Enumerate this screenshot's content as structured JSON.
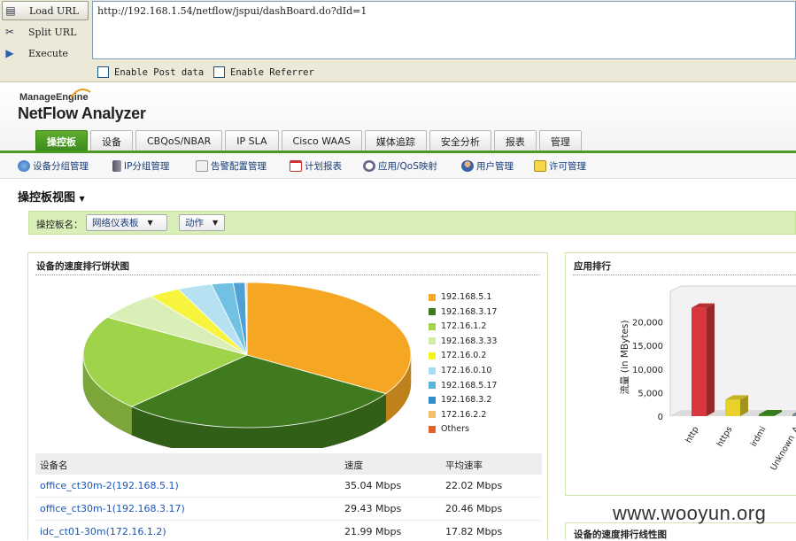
{
  "hackbar": {
    "load_url": "Load URL",
    "split_url": "Split URL",
    "execute": "Execute",
    "url": "http://192.168.1.54/netflow/jspui/dashBoard.do?dId=1",
    "enable_post": "Enable Post data",
    "enable_referrer": "Enable Referrer"
  },
  "brand": {
    "company": "ManageEngine",
    "product": "NetFlow Analyzer",
    "accent": "#4a9a22"
  },
  "tabs": [
    "操控板",
    "设备",
    "CBQoS/NBAR",
    "IP SLA",
    "Cisco WAAS",
    "媒体追踪",
    "安全分析",
    "报表",
    "管理"
  ],
  "subnav": [
    "设备分组管理",
    "IP分组管理",
    "告警配置管理",
    "计划报表",
    "应用/QoS映射",
    "用户管理",
    "许可管理"
  ],
  "page_title": "操控板视图",
  "dashboard": {
    "label": "操控板名：",
    "selected": "网络仪表板",
    "action": "动作"
  },
  "pie_panel": {
    "title": "设备的速度排行饼状图",
    "legend": [
      {
        "name": "192.168.5.1",
        "color": "#f5a623"
      },
      {
        "name": "192.168.3.17",
        "color": "#3f7a1e"
      },
      {
        "name": "172.16.1.2",
        "color": "#9fd34a"
      },
      {
        "name": "192.168.3.33",
        "color": "#d3ecaa"
      },
      {
        "name": "172.16.0.2",
        "color": "#f4f21a"
      },
      {
        "name": "172.16.0.10",
        "color": "#a8dcf0"
      },
      {
        "name": "192.168.5.17",
        "color": "#58b6de"
      },
      {
        "name": "192.168.3.2",
        "color": "#2f8fce"
      },
      {
        "name": "172.16.2.2",
        "color": "#f3c06a"
      },
      {
        "name": "Others",
        "color": "#e0622a"
      }
    ]
  },
  "table": {
    "headers": [
      "设备名",
      "速度",
      "平均速率"
    ],
    "rows": [
      [
        "office_ct30m-2(192.168.5.1)",
        "35.04 Mbps",
        "22.02 Mbps"
      ],
      [
        "office_ct30m-1(192.168.3.17)",
        "29.43 Mbps",
        "20.46 Mbps"
      ],
      [
        "idc_ct01-30m(172.16.1.2)",
        "21.99 Mbps",
        "17.82 Mbps"
      ]
    ]
  },
  "app_panel": {
    "title": "应用排行",
    "ylabel": "流量 (in MBytes)",
    "yticks": [
      "20,000",
      "15,000",
      "10,000",
      "5,000",
      "0"
    ],
    "categories": [
      "http",
      "https",
      "irdmi",
      "Unknown_A"
    ]
  },
  "bottom_panel": {
    "title": "设备的速度排行线性图"
  },
  "chart_data": [
    {
      "type": "pie",
      "title": "设备的速度排行饼状图",
      "categories": [
        "192.168.5.1",
        "192.168.3.17",
        "172.16.1.2",
        "192.168.3.33",
        "172.16.0.2",
        "172.16.0.10",
        "192.168.5.17",
        "192.168.3.2",
        "172.16.2.2",
        "Others"
      ],
      "values": [
        35.04,
        29.43,
        21.99,
        6.5,
        3.2,
        3.5,
        2.2,
        1.2,
        0.1,
        0.1
      ],
      "colors": [
        "#f5a623",
        "#3f7a1e",
        "#9fd34a",
        "#d3ecaa",
        "#f4f21a",
        "#a8dcf0",
        "#58b6de",
        "#2f8fce",
        "#f3c06a",
        "#e0622a"
      ],
      "legend": "right"
    },
    {
      "type": "bar",
      "title": "应用排行",
      "categories": [
        "http",
        "https",
        "irdmi",
        "Unknown_A"
      ],
      "values": [
        23000,
        3500,
        300,
        100
      ],
      "colors": [
        "#d9373b",
        "#e8d22a",
        "#3f8f1e",
        "#7a8a96"
      ],
      "ylabel": "流量 (in MBytes)",
      "ylim": [
        0,
        25000
      ]
    }
  ],
  "watermark": "www.wooyun.org"
}
